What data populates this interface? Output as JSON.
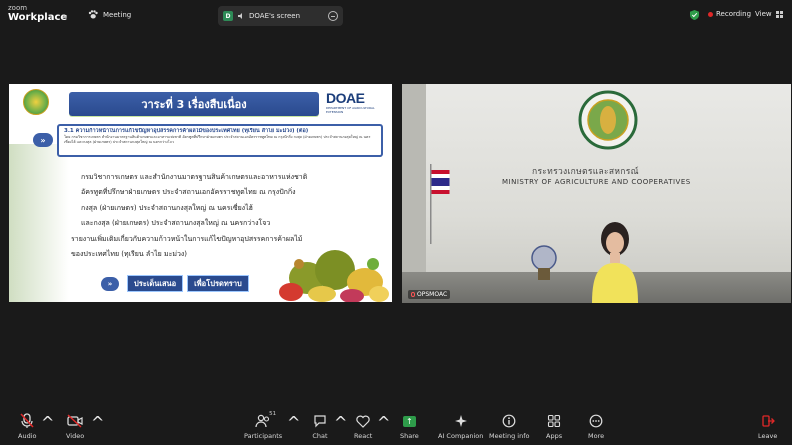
{
  "topbar": {
    "app_line1": "zoom",
    "app_line2": "Workplace",
    "meeting_label": "Meeting",
    "screen_badge": "D",
    "screen_label": "DOAE's screen",
    "recording_label": "Recording",
    "view_label": "View"
  },
  "slide": {
    "title": "วาระที่ 3 เรื่องสืบเนื่อง",
    "logo_text": "DOAE",
    "logo_sub": "DEPARTMENT OF AGRICULTURAL EXTENSION",
    "subtitle": "3.1 ความก้าวหน้าในการแก้ไขปัญหาอุปสรรคการค้าผลไม้ของประเทศไทย (ทุเรียน ลำไย มะม่วง) (ต่อ)",
    "subtitle_detail": "โดย กรมวิชาการเกษตร สำนักงานมาตรฐานสินค้าเกษตรและอาหารแห่งชาติ อัครทูตที่ปรึกษาฝ่ายเกษตร ประจำสถานเอกอัครราชทูตไทย ณ กรุงปักกิ่ง กงสุล (ฝ่ายเกษตร) ประจำสถานกงสุลใหญ่ ณ นครเซี่ยงไฮ้ และกงสุล (ฝ่ายเกษตร) ประจำสถานกงสุลใหญ่ ณ นครกว่างโจว",
    "body_lines": [
      "กรมวิชาการเกษตร และสำนักงานมาตรฐานสินค้าเกษตรและอาหารแห่งชาติ",
      "อัครทูตที่ปรึกษาฝ่ายเกษตร ประจำสถานเอกอัครราชทูตไทย ณ กรุงปักกิ่ง",
      "กงสุล (ฝ่ายเกษตร) ประจำสถานกงสุลใหญ่ ณ นครเซี่ยงไฮ้",
      "และกงสุล (ฝ่ายเกษตร) ประจำสถานกงสุลใหญ่ ณ นครกว่างโจว",
      "รายงานเพิ่มเติมเกี่ยวกับความก้าวหน้าในการแก้ไขปัญหาอุปสรรคการค้าผลไม้",
      "ของประเทศไทย (ทุเรียน ลำไย มะม่วง)"
    ],
    "arrow": "»",
    "btn_issue": "ประเด็นเสนอ",
    "btn_ack": "เพื่อโปรดทราบ"
  },
  "video": {
    "ministry_th": "กระทรวงเกษตรและสหกรณ์",
    "ministry_en": "MINISTRY OF AGRICULTURE AND COOPERATIVES",
    "participant_name": "OPSMOAC"
  },
  "toolbar": {
    "audio": "Audio",
    "video": "Video",
    "participants": "Participants",
    "participants_count": "51",
    "chat": "Chat",
    "react": "React",
    "share": "Share",
    "ai": "AI Companion",
    "info": "Meeting info",
    "apps": "Apps",
    "more": "More",
    "leave": "Leave"
  },
  "colors": {
    "accent_green": "#2e9c4a",
    "recording_red": "#e02828",
    "slide_blue": "#2a4a8e"
  }
}
